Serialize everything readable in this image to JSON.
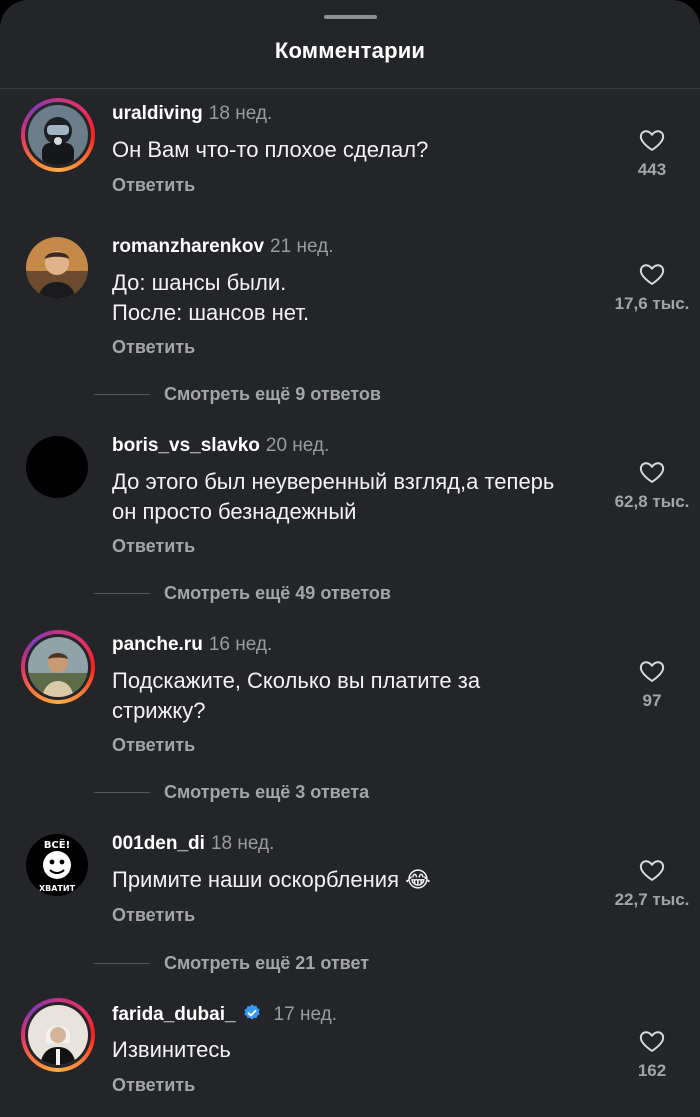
{
  "header": {
    "title": "Комментарии"
  },
  "comments": [
    {
      "username": "uraldiving",
      "time": "18 нед.",
      "text": [
        "Он Вам что-то плохое сделал?"
      ],
      "reply": "Ответить",
      "likes": "443",
      "avatar_icon": "diver-avatar",
      "story_ring": true
    },
    {
      "username": "romanzharenkov",
      "time": "21 нед.",
      "text": [
        "До: шансы были.",
        "После: шансов нет."
      ],
      "reply": "Ответить",
      "likes": "17,6 тыс.",
      "avatar_icon": "man-photo-avatar",
      "story_ring": false
    },
    {
      "username": "boris_vs_slavko",
      "time": "20 нед.",
      "text": [
        "До этого был неуверенный взгляд,а теперь",
        "он просто безнадежный"
      ],
      "reply": "Ответить",
      "likes": "62,8 тыс.",
      "avatar_icon": "black-avatar",
      "story_ring": false
    },
    {
      "username": "panche.ru",
      "time": "16 нед.",
      "text": [
        "Подскажите, Сколько вы платите за",
        "стрижку?"
      ],
      "reply": "Ответить",
      "likes": "97",
      "avatar_icon": "man-outdoor-avatar",
      "story_ring": true
    },
    {
      "username": "001den_di",
      "time": "18 нед.",
      "text": [
        "Примите наши оскорбления 😂"
      ],
      "reply": "Ответить",
      "likes": "22,7 тыс.",
      "avatar_icon": "logo-avatar",
      "story_ring": false,
      "avatar_text": [
        "ВСЁ!",
        "ХВАТИТ"
      ]
    },
    {
      "username": "farida_dubai_",
      "time": "17 нед.",
      "text": [
        "Извинитесь"
      ],
      "reply": "Ответить",
      "likes": "162",
      "avatar_icon": "woman-photo-avatar",
      "story_ring": true,
      "verified": true
    }
  ],
  "view_more": [
    "Смотреть ещё 9 ответов",
    "Смотреть ещё 49 ответов",
    "Смотреть ещё 3 ответа",
    "Смотреть ещё 21 ответ"
  ],
  "colors": {
    "background": "#242528",
    "text_muted": "#a4a5aa",
    "verified": "#3897f0"
  }
}
